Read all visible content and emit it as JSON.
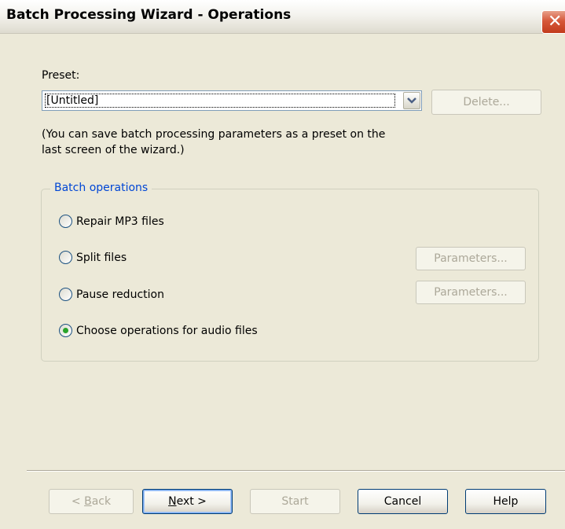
{
  "window": {
    "title": "Batch Processing Wizard - Operations",
    "close_glyph": "✕"
  },
  "preset": {
    "label": "Preset:",
    "value": "[Untitled]",
    "delete_label": "Delete...",
    "hint": "(You can save batch processing parameters as a preset on the last screen of the wizard.)",
    "hint_line1": "(You can save batch processing parameters as a preset on the",
    "hint_line2": "last screen of the wizard.)"
  },
  "batch_operations": {
    "title": "Batch operations",
    "options": [
      {
        "label": "Repair MP3 files",
        "selected": false,
        "parameters_label": null
      },
      {
        "label": "Split files",
        "selected": false,
        "parameters_label": "Parameters..."
      },
      {
        "label": "Pause reduction",
        "selected": false,
        "parameters_label": "Parameters..."
      },
      {
        "label": "Choose operations for audio files",
        "selected": true,
        "parameters_label": null
      }
    ]
  },
  "footer": {
    "back_label": "< Back",
    "back_prefix": "< ",
    "back_hotkey": "B",
    "back_rest": "ack",
    "next_hotkey": "N",
    "next_rest": "ext >",
    "start_label": "Start",
    "cancel_label": "Cancel",
    "help_label": "Help"
  },
  "colors": {
    "dialog_bg": "#ece9d8",
    "group_title": "#0046d5",
    "radio_selected": "#2aa32a",
    "close_button": "#d6583a"
  }
}
